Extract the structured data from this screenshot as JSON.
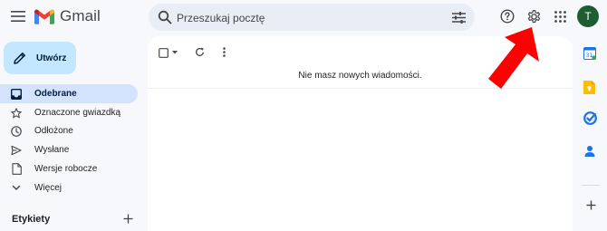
{
  "header": {
    "app_name": "Gmail",
    "search_placeholder": "Przeszukaj pocztę",
    "avatar_initial": "T"
  },
  "compose": {
    "label": "Utwórz"
  },
  "nav": [
    {
      "label": "Odebrane",
      "icon": "inbox-icon",
      "active": true
    },
    {
      "label": "Oznaczone gwiazdką",
      "icon": "star-icon"
    },
    {
      "label": "Odłożone",
      "icon": "clock-icon"
    },
    {
      "label": "Wysłane",
      "icon": "send-icon"
    },
    {
      "label": "Wersje robocze",
      "icon": "draft-icon"
    },
    {
      "label": "Więcej",
      "icon": "chevron-down-icon"
    }
  ],
  "labels": {
    "heading": "Etykiety"
  },
  "main": {
    "empty_message": "Nie masz nowych wiadomości."
  },
  "rail": [
    {
      "icon": "calendar-icon",
      "color": "#1a73e8"
    },
    {
      "icon": "keep-icon",
      "color": "#fbbc04"
    },
    {
      "icon": "tasks-icon",
      "color": "#1a73e8"
    },
    {
      "icon": "contacts-icon",
      "color": "#1a73e8"
    }
  ],
  "colors": {
    "background": "#f6f8fc",
    "compose": "#c2e7ff",
    "active_nav": "#d3e3fd",
    "annotation_arrow": "#ff0000",
    "avatar": "#1e5c32"
  }
}
